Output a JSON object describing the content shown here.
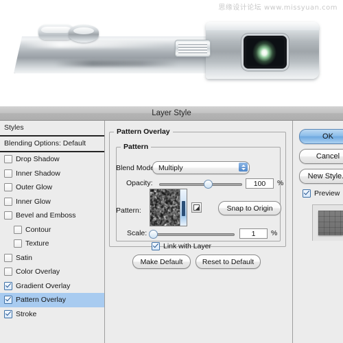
{
  "watermark": "思缘设计论坛  www.missyuan.com",
  "photo": {
    "subject": "silver-camera-top-with-viewfinder"
  },
  "dialog": {
    "title": "Layer Style",
    "sidebar": {
      "header": "Styles",
      "blending_options": "Blending Options: Default",
      "items": [
        {
          "label": "Drop Shadow",
          "checked": false,
          "indent": false,
          "selected": false
        },
        {
          "label": "Inner Shadow",
          "checked": false,
          "indent": false,
          "selected": false
        },
        {
          "label": "Outer Glow",
          "checked": false,
          "indent": false,
          "selected": false
        },
        {
          "label": "Inner Glow",
          "checked": false,
          "indent": false,
          "selected": false
        },
        {
          "label": "Bevel and Emboss",
          "checked": false,
          "indent": false,
          "selected": false
        },
        {
          "label": "Contour",
          "checked": false,
          "indent": true,
          "selected": false
        },
        {
          "label": "Texture",
          "checked": false,
          "indent": true,
          "selected": false
        },
        {
          "label": "Satin",
          "checked": false,
          "indent": false,
          "selected": false
        },
        {
          "label": "Color Overlay",
          "checked": false,
          "indent": false,
          "selected": false
        },
        {
          "label": "Gradient Overlay",
          "checked": true,
          "indent": false,
          "selected": false
        },
        {
          "label": "Pattern Overlay",
          "checked": true,
          "indent": false,
          "selected": true
        },
        {
          "label": "Stroke",
          "checked": true,
          "indent": false,
          "selected": false
        }
      ]
    },
    "main": {
      "group_title": "Pattern Overlay",
      "subgroup_title": "Pattern",
      "blend_mode": {
        "label": "Blend Mode:",
        "value": "Multiply"
      },
      "opacity": {
        "label": "Opacity:",
        "value": "100",
        "unit": "%",
        "percent": 100
      },
      "pattern": {
        "label": "Pattern:",
        "snap_button": "Snap to Origin"
      },
      "scale": {
        "label": "Scale:",
        "value": "1",
        "unit": "%",
        "percent": 0
      },
      "link_with_layer": {
        "label": "Link with Layer",
        "checked": true
      },
      "make_default": "Make Default",
      "reset_to_default": "Reset to Default"
    },
    "right": {
      "ok": "OK",
      "cancel": "Cancel",
      "new_style": "New Style...",
      "preview": {
        "label": "Preview",
        "checked": true
      }
    }
  },
  "colors": {
    "selection_blue": "#a8cbf0",
    "ok_button_blue": "#8dbdea",
    "dialog_bg": "#ececec",
    "titlebar": "#bcbcbc"
  }
}
